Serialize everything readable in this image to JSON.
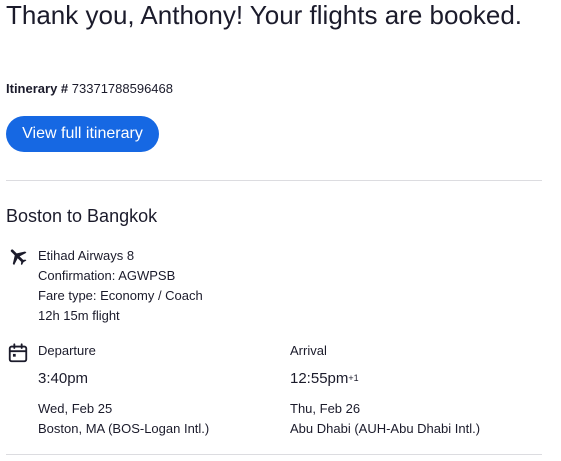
{
  "header": {
    "title": "Thank you, Anthony! Your flights are booked.",
    "itinerary_label": "Itinerary #",
    "itinerary_number": "73371788596468",
    "view_button_label": "View full itinerary"
  },
  "flight": {
    "route": "Boston to Bangkok",
    "airline": "Etihad Airways 8",
    "confirmation": "Confirmation: AGWPSB",
    "fare_type": "Fare type: Economy / Coach",
    "duration": "12h 15m flight",
    "icons": {
      "flight": "airplane-icon",
      "schedule": "calendar-icon"
    }
  },
  "departure": {
    "label": "Departure",
    "time": "3:40pm",
    "date": "Wed, Feb 25",
    "airport": "Boston, MA (BOS-Logan Intl.)"
  },
  "arrival": {
    "label": "Arrival",
    "time": "12:55pm",
    "day_offset": "+1",
    "date": "Thu, Feb 26",
    "airport": "Abu Dhabi (AUH-Abu Dhabi Intl.)"
  },
  "colors": {
    "accent": "#1668e3",
    "text": "#1b1b2b",
    "divider": "#dcdce0"
  }
}
